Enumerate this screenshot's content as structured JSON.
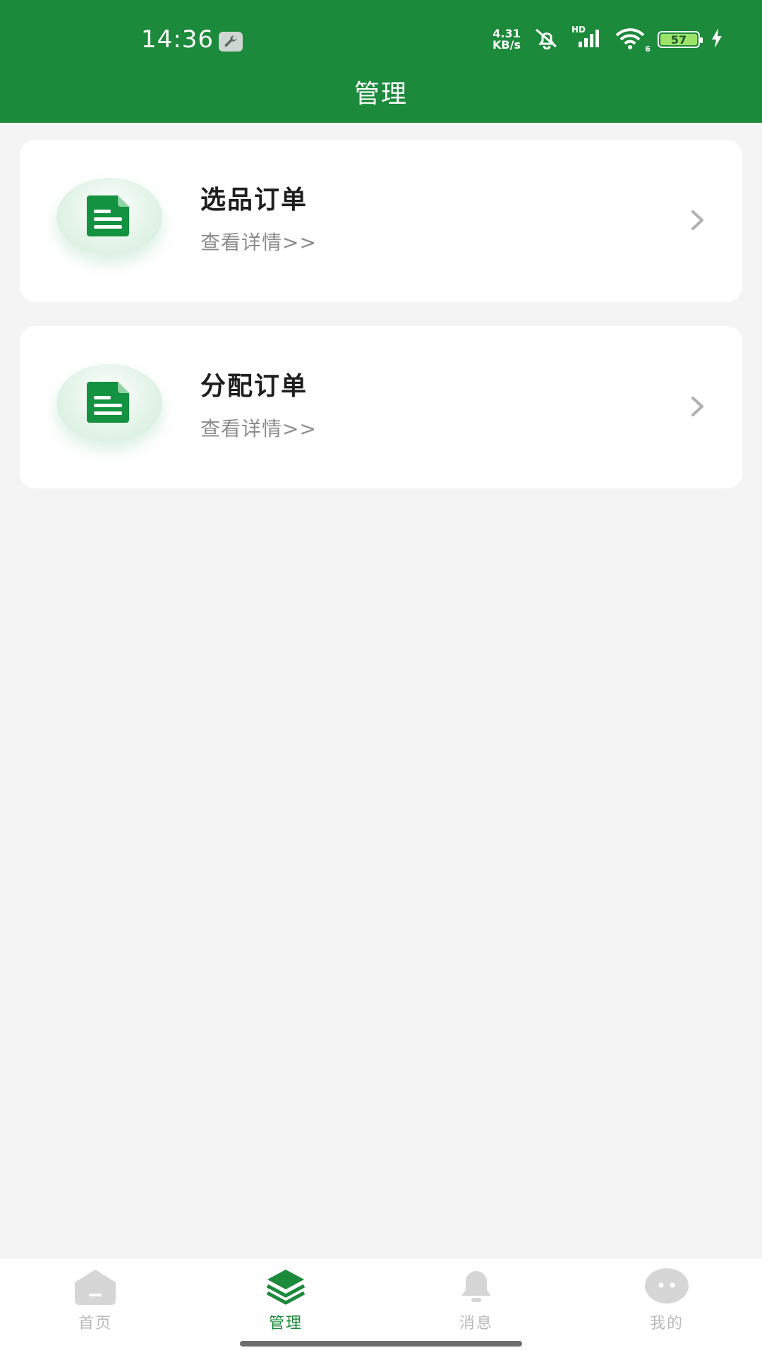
{
  "status_bar": {
    "time": "14:36",
    "net_speed_value": "4.31",
    "net_speed_unit": "KB/s",
    "signal_label": "HD",
    "wifi_label": "6",
    "battery": "57"
  },
  "header": {
    "title": "管理"
  },
  "cards": [
    {
      "title": "选品订单",
      "subtitle": "查看详情>>"
    },
    {
      "title": "分配订单",
      "subtitle": "查看详情>>"
    }
  ],
  "bottom_nav": {
    "items": [
      {
        "label": "首页",
        "icon": "home-icon",
        "active": false
      },
      {
        "label": "管理",
        "icon": "layers-icon",
        "active": true
      },
      {
        "label": "消息",
        "icon": "bell-icon",
        "active": false
      },
      {
        "label": "我的",
        "icon": "chat-bubble-icon",
        "active": false
      }
    ]
  },
  "colors": {
    "primary": "#1b8a3a",
    "background": "#f4f4f4",
    "inactive": "#b9b9b9"
  }
}
